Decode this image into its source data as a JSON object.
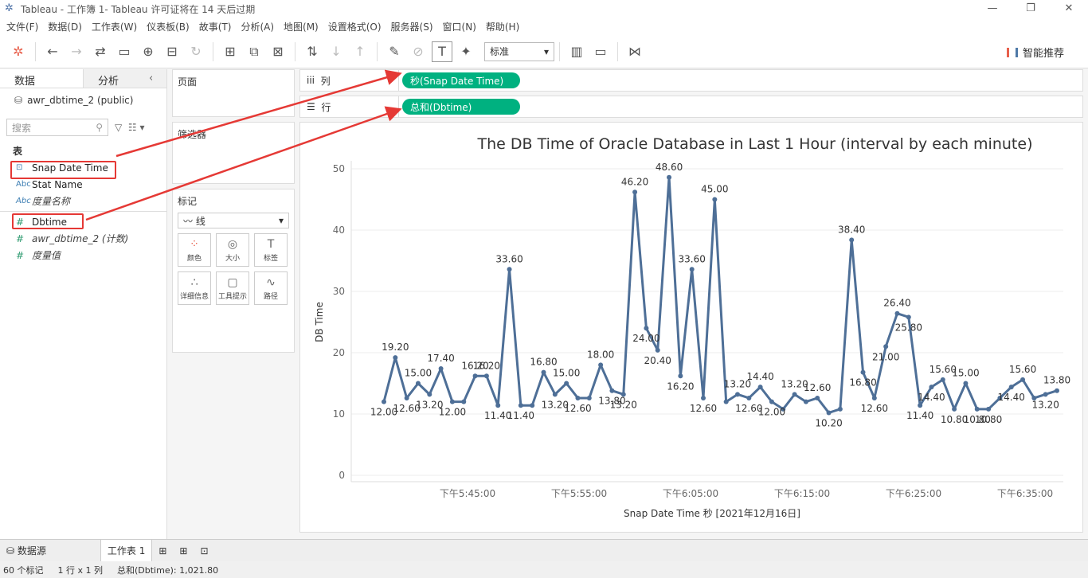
{
  "window": {
    "title": "Tableau - 工作簿 1- Tableau 许可证将在 14 天后过期"
  },
  "menu": [
    "文件(F)",
    "数据(D)",
    "工作表(W)",
    "仪表板(B)",
    "故事(T)",
    "分析(A)",
    "地图(M)",
    "设置格式(O)",
    "服务器(S)",
    "窗口(N)",
    "帮助(H)"
  ],
  "toolbar": {
    "fit_select": "标准",
    "smart_label": "智能推荐"
  },
  "left": {
    "tab_data": "数据",
    "tab_analysis": "分析",
    "datasource": "awr_dbtime_2 (public)",
    "search_placeholder": "搜索",
    "section_table": "表",
    "fields": [
      {
        "icon": "date",
        "name": "Snap Date Time"
      },
      {
        "icon": "Abc",
        "name": "Stat Name"
      },
      {
        "icon": "Abc",
        "name": "度量名称"
      },
      {
        "icon": "#",
        "name": "Dbtime"
      },
      {
        "icon": "#",
        "name": "awr_dbtime_2 (计数)"
      },
      {
        "icon": "#",
        "name": "度量值"
      }
    ]
  },
  "mid": {
    "pages": "页面",
    "filters": "筛选器",
    "marks": "标记",
    "mark_type": "线",
    "mark_cells": [
      "颜色",
      "大小",
      "标签",
      "详细信息",
      "工具提示",
      "路径"
    ]
  },
  "shelves": {
    "columns_label": "列",
    "columns_pill": "秒(Snap Date Time)",
    "rows_label": "行",
    "rows_pill": "总和(Dbtime)"
  },
  "chart_data": {
    "type": "line",
    "title": "The DB Time of Oracle Database in Last 1 Hour (interval by each minute)",
    "xlabel": "Snap Date Time 秒 [2021年12月16日]",
    "ylabel": "DB Time",
    "ylim": [
      0,
      50
    ],
    "yticks": [
      0,
      10,
      20,
      30,
      40,
      50
    ],
    "x_tick_labels": [
      "下午5:45:00",
      "下午5:55:00",
      "下午6:05:00",
      "下午6:15:00",
      "下午6:25:00",
      "下午6:35:00"
    ],
    "values": [
      12.0,
      19.2,
      12.6,
      15.0,
      13.2,
      17.4,
      12.0,
      12.0,
      16.2,
      16.2,
      11.4,
      33.6,
      11.4,
      11.4,
      16.8,
      13.2,
      15.0,
      12.6,
      12.6,
      18.0,
      13.8,
      13.2,
      46.2,
      24.0,
      20.4,
      48.6,
      16.2,
      33.6,
      12.6,
      45.0,
      12.0,
      13.2,
      12.6,
      14.4,
      12.0,
      10.8,
      13.2,
      12.0,
      12.6,
      10.2,
      10.8,
      38.4,
      16.8,
      12.6,
      21.0,
      26.4,
      25.8,
      11.4,
      14.4,
      15.6,
      10.8,
      15.0,
      10.8,
      10.8,
      12.6,
      14.4,
      15.6,
      12.6,
      13.2,
      13.8
    ],
    "labels": [
      "12.00",
      "19.20",
      "12.60",
      "15.00",
      "13.20",
      "17.40",
      "12.00",
      "16.20",
      "16.20",
      "11.40",
      "33.60",
      "11.40",
      "16.80",
      "13.20",
      "15.00",
      "12.60",
      "18.00",
      "13.80",
      "13.20",
      "46.20",
      "24.00",
      "20.40",
      "48.60",
      "16.20",
      "33.60",
      "12.60",
      "45.00",
      "13.20",
      "12.60",
      "14.40",
      "12.00",
      "13.20",
      "12.60",
      "10.20",
      "38.40",
      "16.80",
      "12.60",
      "21.00",
      "26.40",
      "25.80",
      "11.40",
      "14.40",
      "15.60",
      "10.80",
      "15.00",
      "10.80",
      "10.80",
      "14.40",
      "15.60",
      "13.20",
      "13.80"
    ],
    "line_color": "#4e6f97"
  },
  "bottom": {
    "datasource_tab": "数据源",
    "sheet_tab": "工作表 1"
  },
  "status": {
    "marks": "60 个标记",
    "dims": "1 行 x 1 列",
    "sum": "总和(Dbtime): 1,021.80"
  }
}
